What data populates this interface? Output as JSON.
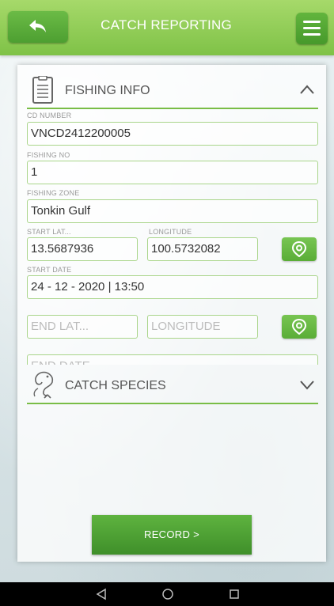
{
  "header": {
    "title": "CATCH REPORTING",
    "back_icon": "back-arrow-icon",
    "menu_icon": "hamburger-menu-icon"
  },
  "fishing_info": {
    "section_title": "FISHING INFO",
    "section_icon": "document-icon",
    "expanded": true,
    "cd_number": {
      "label": "CD NUMBER",
      "value": "VNCD2412200005"
    },
    "fishing_no": {
      "label": "FISHING NO",
      "value": "1"
    },
    "fishing_zone": {
      "label": "FISHING ZONE",
      "value": "Tonkin Gulf"
    },
    "start_lat": {
      "label": "START LAT...",
      "value": "13.5687936"
    },
    "start_lon": {
      "label": "LONGITUDE",
      "value": "100.5732082"
    },
    "start_date": {
      "label": "START DATE",
      "value": "24 - 12 - 2020 | 13:50"
    },
    "end_lat": {
      "placeholder": "END LAT..."
    },
    "end_lon": {
      "placeholder": "LONGITUDE"
    },
    "end_date": {
      "placeholder": "END DATE"
    }
  },
  "catch_species": {
    "section_title": "CATCH SPECIES",
    "section_icon": "fish-icon",
    "expanded": false
  },
  "record_button": {
    "label": "RECORD >"
  },
  "nav": {
    "back": "back-triangle-icon",
    "home": "home-circle-icon",
    "recents": "recents-square-icon"
  },
  "colors": {
    "accent": "#6bbb46",
    "header": "#8ccc52",
    "field_border": "#a9d58a"
  }
}
